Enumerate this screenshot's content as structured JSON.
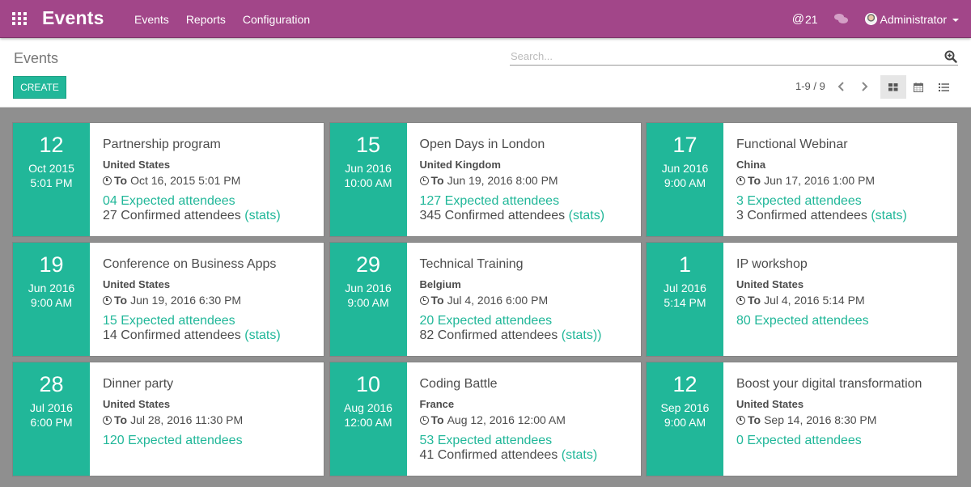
{
  "navbar": {
    "app_title": "Events",
    "menu": [
      "Events",
      "Reports",
      "Configuration"
    ],
    "mentions_count": "21",
    "mentions_symbol": "@",
    "user_name": "Administrator"
  },
  "control_panel": {
    "breadcrumb": "Events",
    "create_label": "CREATE",
    "search_placeholder": "Search...",
    "pager": "1-9 / 9",
    "views": [
      "kanban",
      "calendar",
      "list"
    ],
    "active_view": "kanban"
  },
  "colors": {
    "navbar": "#a24689",
    "accent": "#21b799",
    "background": "#8f8f8f"
  },
  "events": [
    {
      "day": "12",
      "month_year": "Oct 2015",
      "time": "5:01 PM",
      "title": "Partnership program",
      "country": "United States",
      "to_label": "To",
      "end": "Oct 16, 2015 5:01 PM",
      "expected": "04 Expected attendees",
      "confirmed": "27 Confirmed attendees",
      "stats": "(stats)"
    },
    {
      "day": "15",
      "month_year": "Jun 2016",
      "time": "10:00 AM",
      "title": "Open Days in London",
      "country": "United Kingdom",
      "to_label": "To",
      "end": "Jun 19, 2016 8:00 PM",
      "expected": "127 Expected attendees",
      "confirmed": "345 Confirmed attendees",
      "stats": "(stats)"
    },
    {
      "day": "17",
      "month_year": "Jun 2016",
      "time": "9:00 AM",
      "title": "Functional Webinar",
      "country": "China",
      "to_label": "To",
      "end": "Jun 17, 2016 1:00 PM",
      "expected": "3 Expected attendees",
      "confirmed": "3 Confirmed attendees",
      "stats": "(stats)"
    },
    {
      "day": "19",
      "month_year": "Jun 2016",
      "time": "9:00 AM",
      "title": "Conference on Business Apps",
      "country": "United States",
      "to_label": "To",
      "end": "Jun 19, 2016 6:30 PM",
      "expected": "15 Expected attendees",
      "confirmed": "14 Confirmed attendees",
      "stats": "(stats)"
    },
    {
      "day": "29",
      "month_year": "Jun 2016",
      "time": "9:00 AM",
      "title": "Technical Training",
      "country": "Belgium",
      "to_label": "To",
      "end": "Jul 4, 2016 6:00 PM",
      "expected": "20 Expected attendees",
      "confirmed": "82 Confirmed attendees",
      "stats": "(stats))"
    },
    {
      "day": "1",
      "month_year": "Jul 2016",
      "time": "5:14 PM",
      "title": "IP workshop",
      "country": "United States",
      "to_label": "To",
      "end": "Jul 4, 2016 5:14 PM",
      "expected": "80 Expected attendees",
      "confirmed": null,
      "stats": null
    },
    {
      "day": "28",
      "month_year": "Jul 2016",
      "time": "6:00 PM",
      "title": "Dinner party",
      "country": "United States",
      "to_label": "To",
      "end": "Jul 28, 2016 11:30 PM",
      "expected": "120 Expected attendees",
      "confirmed": null,
      "stats": null
    },
    {
      "day": "10",
      "month_year": "Aug 2016",
      "time": "12:00 AM",
      "title": "Coding Battle",
      "country": "France",
      "to_label": "To",
      "end": "Aug 12, 2016 12:00 AM",
      "expected": "53 Expected attendees",
      "confirmed": "41 Confirmed attendees",
      "stats": "(stats)"
    },
    {
      "day": "12",
      "month_year": "Sep 2016",
      "time": "9:00 AM",
      "title": "Boost your digital transformation",
      "country": "United States",
      "to_label": "To",
      "end": "Sep 14, 2016 8:30 PM",
      "expected": "0 Expected attendees",
      "confirmed": null,
      "stats": null
    }
  ]
}
